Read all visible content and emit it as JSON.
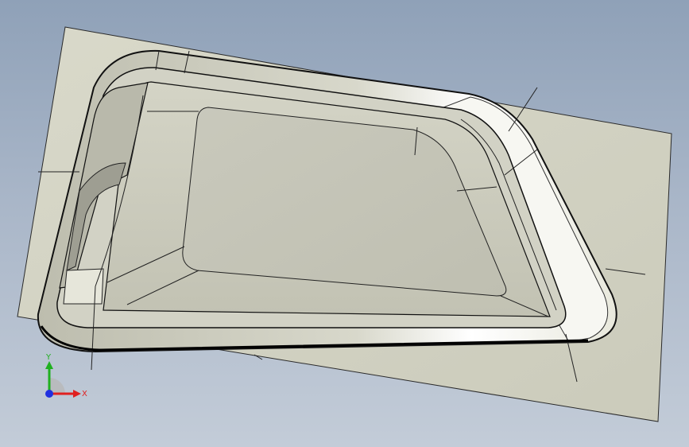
{
  "triad": {
    "x_label": "X",
    "y_label": "Y",
    "x_color": "#e02020",
    "y_color": "#20b020",
    "z_color": "#2030e0"
  },
  "colors": {
    "background_top": "#8fa1b8",
    "background_bottom": "#c3ccd8",
    "sheet_fill": "#d8d8c8",
    "part_fill": "#cfcfc2",
    "edge": "#1a1a1a"
  }
}
